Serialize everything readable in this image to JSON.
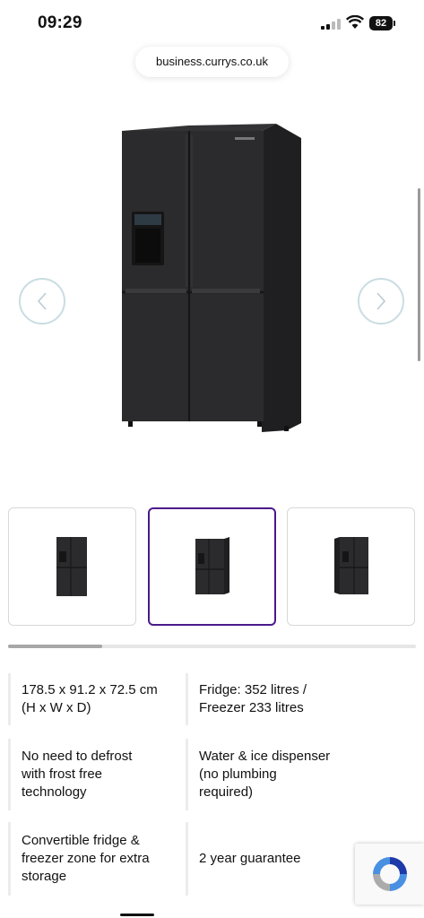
{
  "status_bar": {
    "time": "09:29",
    "battery": "82"
  },
  "browser": {
    "url": "business.currys.co.uk"
  },
  "carousel": {
    "prev_icon": "chevron-left-icon",
    "next_icon": "chevron-right-icon",
    "thumbnails": [
      "thumbnail-1",
      "thumbnail-2",
      "thumbnail-3"
    ],
    "selected_index": 1,
    "scroll_progress": 0.23
  },
  "features": [
    {
      "line1": "178.5 x 91.2 x 72.5 cm",
      "line2": "(H x W x D)",
      "line3": ""
    },
    {
      "line1": "Fridge: 352 litres /",
      "line2": "Freezer 233 litres",
      "line3": ""
    },
    {
      "line1": "No need to defrost",
      "line2": "with frost free",
      "line3": "technology"
    },
    {
      "line1": "Water & ice dispenser",
      "line2": "(no plumbing",
      "line3": "required)"
    },
    {
      "line1": "Convertible fridge &",
      "line2": "freezer zone for extra",
      "line3": "storage"
    },
    {
      "line1": "2 year guarantee",
      "line2": "",
      "line3": ""
    }
  ],
  "colors": {
    "accent": "#4b1a8c",
    "arrow_border": "#c9dde3",
    "fridge": "#2b2b2d"
  },
  "recaptcha": {
    "icon": "recaptcha-icon"
  }
}
